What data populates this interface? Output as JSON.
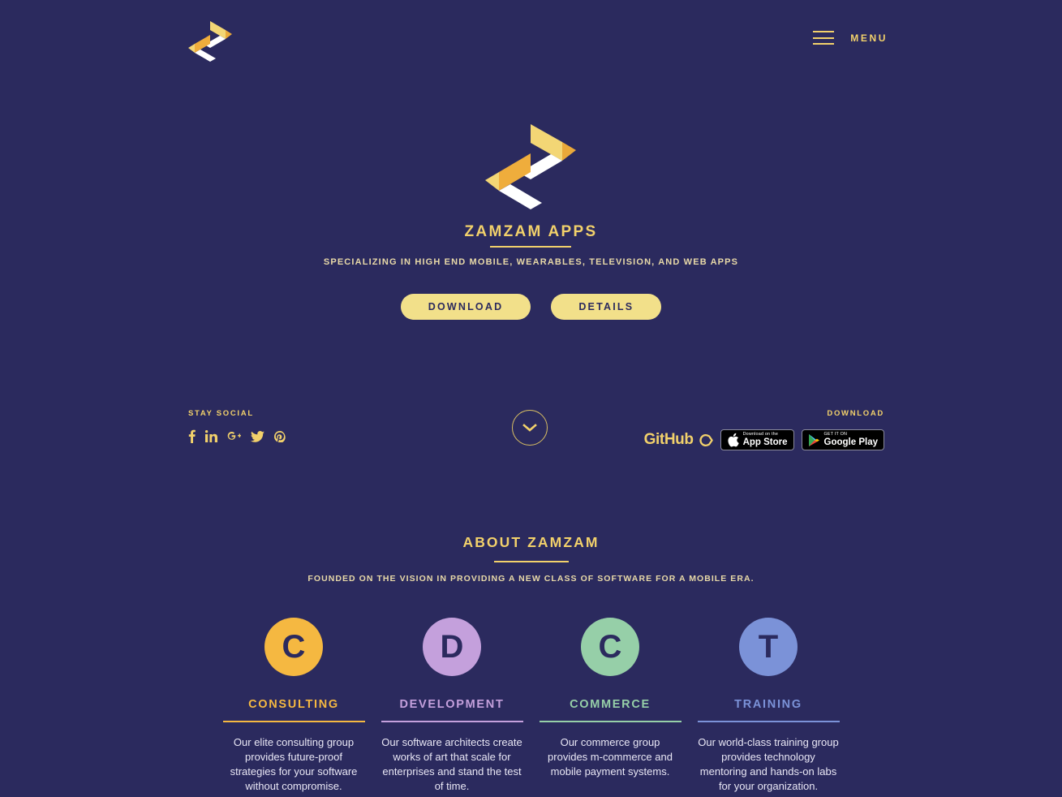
{
  "theme": {
    "background": "#2b2a5e",
    "accent": "#f2d16b",
    "button_bg": "#f2e08a",
    "button_text": "#2b2a5e",
    "body_text": "#e9e7f5"
  },
  "header": {
    "logo_icon": "zamzam-chevron-logo",
    "menu_icon": "hamburger-icon",
    "menu_label": "MENU"
  },
  "hero": {
    "logo_icon": "zamzam-chevron-logo-large",
    "title": "ZAMZAM APPS",
    "subtitle": "SPECIALIZING IN HIGH END MOBILE, WEARABLES, TELEVISION, AND WEB APPS",
    "buttons": [
      {
        "label": "DOWNLOAD",
        "name": "download-button"
      },
      {
        "label": "DETAILS",
        "name": "details-button"
      }
    ]
  },
  "social": {
    "caption": "STAY SOCIAL",
    "items": [
      {
        "name": "facebook-icon",
        "label": "Facebook"
      },
      {
        "name": "linkedin-icon",
        "label": "LinkedIn"
      },
      {
        "name": "google-plus-icon",
        "label": "Google Plus"
      },
      {
        "name": "twitter-icon",
        "label": "Twitter"
      },
      {
        "name": "pinterest-icon",
        "label": "Pinterest"
      }
    ]
  },
  "scroll": {
    "icon": "chevron-down-icon"
  },
  "download": {
    "caption": "DOWNLOAD",
    "github": {
      "icon": "github-mark-icon",
      "label": "GitHub"
    },
    "app_store": {
      "small": "Download on the",
      "big": "App Store",
      "icon": "apple-icon"
    },
    "google_play": {
      "small": "GET IT ON",
      "big": "Google Play",
      "icon": "google-play-icon"
    }
  },
  "about": {
    "title": "ABOUT ZAMZAM",
    "subtitle": "FOUNDED ON THE VISION IN PROVIDING A NEW CLASS OF SOFTWARE FOR A MOBILE ERA.",
    "cards": [
      {
        "initial": "C",
        "title": "CONSULTING",
        "color": "#f5b841",
        "description": "Our elite consulting group provides future-proof strategies for your software without compromise."
      },
      {
        "initial": "D",
        "title": "DEVELOPMENT",
        "color": "#c4a0dc",
        "description": "Our software architects create works of art that scale for enterprises and stand the test of time."
      },
      {
        "initial": "C",
        "title": "COMMERCE",
        "color": "#96cfa8",
        "description": "Our commerce group provides m-commerce and mobile payment systems."
      },
      {
        "initial": "T",
        "title": "TRAINING",
        "color": "#7b92d8",
        "description": "Our world-class training group provides technology mentoring and hands-on labs for your organization."
      }
    ]
  }
}
